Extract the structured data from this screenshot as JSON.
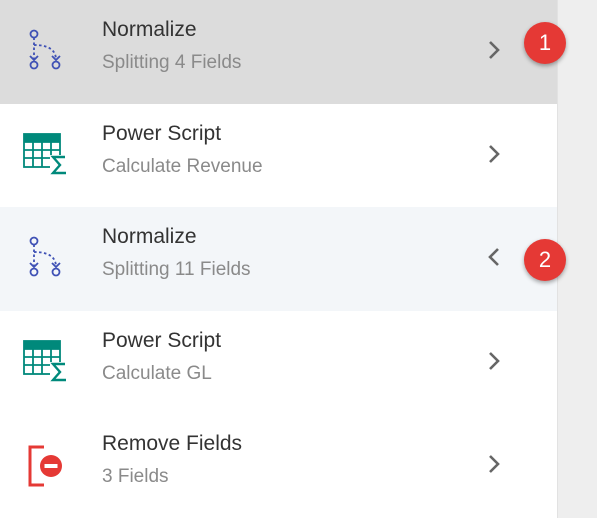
{
  "list": {
    "items": [
      {
        "title": "Normalize",
        "subtitle": "Splitting 4 Fields",
        "icon": "normalize-icon",
        "chevron": "chevron-right-icon",
        "state": "selected"
      },
      {
        "title": "Power Script",
        "subtitle": "Calculate Revenue",
        "icon": "power-script-icon",
        "chevron": "chevron-right-icon",
        "state": "normal"
      },
      {
        "title": "Normalize",
        "subtitle": "Splitting 11 Fields",
        "icon": "normalize-icon",
        "chevron": "chevron-left-icon",
        "state": "expanded"
      },
      {
        "title": "Power Script",
        "subtitle": "Calculate GL",
        "icon": "power-script-icon",
        "chevron": "chevron-right-icon",
        "state": "normal"
      },
      {
        "title": "Remove Fields",
        "subtitle": "3 Fields",
        "icon": "remove-fields-icon",
        "chevron": "chevron-right-icon",
        "state": "normal"
      }
    ]
  },
  "callouts": [
    {
      "label": "1"
    },
    {
      "label": "2"
    }
  ],
  "colors": {
    "selected_row": "#dcdcdc",
    "expanded_row": "#f3f6f9",
    "normalize_icon": "#3f51b5",
    "power_script_icon": "#00897b",
    "remove_fields_icon": "#e53935",
    "badge": "#e53935"
  }
}
